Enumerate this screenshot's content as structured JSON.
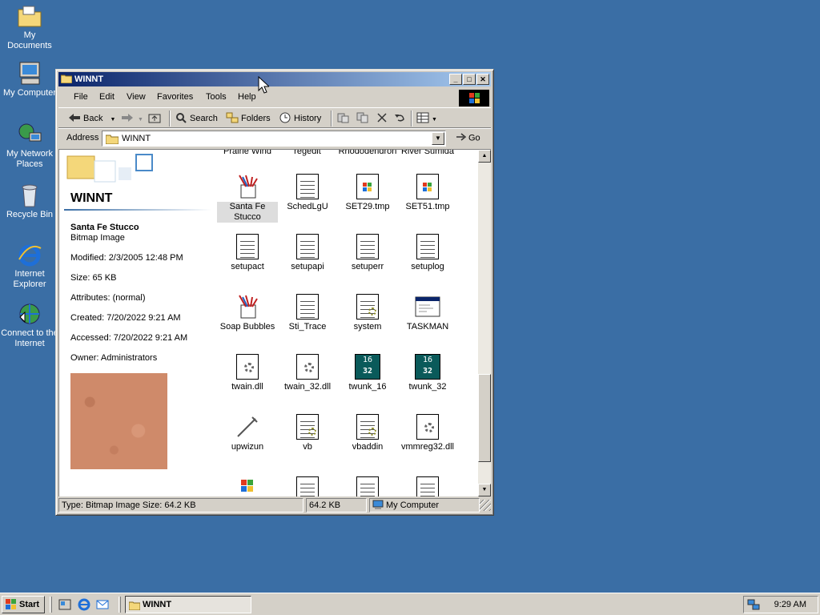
{
  "desktop": {
    "icons": [
      {
        "label": "My Documents"
      },
      {
        "label": "My Computer"
      },
      {
        "label": "My Network Places"
      },
      {
        "label": "Recycle Bin"
      },
      {
        "label": "Internet Explorer"
      },
      {
        "label": "Connect to the Internet"
      }
    ]
  },
  "window": {
    "title": "WINNT",
    "controls": {
      "minimize": "_",
      "maximize": "□",
      "close": "✕"
    },
    "menu": [
      "File",
      "Edit",
      "View",
      "Favorites",
      "Tools",
      "Help"
    ],
    "toolbar": {
      "back": "Back",
      "search": "Search",
      "folders": "Folders",
      "history": "History"
    },
    "address": {
      "label": "Address",
      "value": "WINNT",
      "go": "Go"
    },
    "details": {
      "folder_title": "WINNT",
      "file_name": "Santa Fe Stucco",
      "file_type": "Bitmap Image",
      "modified": "Modified: 2/3/2005 12:48 PM",
      "size": "Size: 65 KB",
      "attributes": "Attributes: (normal)",
      "created": "Created: 7/20/2022 9:21 AM",
      "accessed": "Accessed: 7/20/2022 9:21 AM",
      "owner": "Owner: Administrators"
    },
    "files_cut_row": [
      "Prairie Wind",
      "regedit",
      "Rhododendron",
      "River Sumida"
    ],
    "files": [
      {
        "label": "Santa Fe Stucco",
        "icon": "paint-icon",
        "selected": true
      },
      {
        "label": "SchedLgU",
        "icon": "text-doc-icon"
      },
      {
        "label": "SET29.tmp",
        "icon": "windows-file-icon"
      },
      {
        "label": "SET51.tmp",
        "icon": "windows-file-icon"
      },
      {
        "label": "setupact",
        "icon": "text-doc-icon"
      },
      {
        "label": "setupapi",
        "icon": "text-doc-icon"
      },
      {
        "label": "setuperr",
        "icon": "text-doc-icon"
      },
      {
        "label": "setuplog",
        "icon": "text-doc-icon"
      },
      {
        "label": "Soap Bubbles",
        "icon": "paint-icon"
      },
      {
        "label": "Sti_Trace",
        "icon": "text-doc-icon"
      },
      {
        "label": "system",
        "icon": "config-doc-icon"
      },
      {
        "label": "TASKMAN",
        "icon": "app-window-icon"
      },
      {
        "label": "twain.dll",
        "icon": "dll-icon"
      },
      {
        "label": "twain_32.dll",
        "icon": "dll-icon"
      },
      {
        "label": "twunk_16",
        "icon": "twain-16-icon"
      },
      {
        "label": "twunk_32",
        "icon": "twain-32-icon"
      },
      {
        "label": "upwizun",
        "icon": "wand-icon"
      },
      {
        "label": "vb",
        "icon": "config-doc-icon"
      },
      {
        "label": "vbaddin",
        "icon": "config-doc-icon"
      },
      {
        "label": "vmmreg32.dll",
        "icon": "dll-icon"
      }
    ],
    "twunk_badges": {
      "top": "16",
      "bottom": "32"
    },
    "status": {
      "info": "Type: Bitmap Image Size: 64.2 KB",
      "size": "64.2 KB",
      "zone": "My Computer"
    }
  },
  "taskbar": {
    "start": "Start",
    "task": "WINNT",
    "clock": "9:29 AM"
  }
}
